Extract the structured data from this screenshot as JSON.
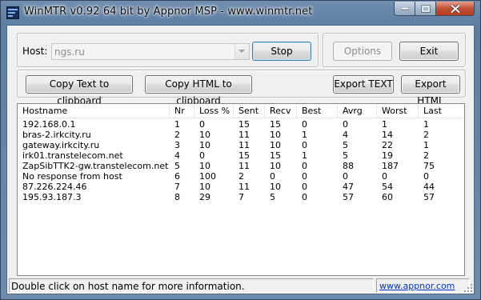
{
  "window": {
    "title": "WinMTR v0.92 64 bit by Appnor MSP - www.winmtr.net",
    "icon": "winmtr-app-icon",
    "controls": [
      "minimize-icon",
      "maximize-icon",
      "close-icon"
    ]
  },
  "host_panel": {
    "label": "Host:",
    "host_value": "ngs.ru",
    "stop_label": "Stop"
  },
  "side_panel": {
    "options_label": "Options",
    "exit_label": "Exit"
  },
  "toolbar": {
    "copy_text_label": "Copy Text to clipboard",
    "copy_html_label": "Copy HTML to clipboard",
    "export_text_label": "Export TEXT",
    "export_html_label": "Export HTML"
  },
  "table": {
    "columns": [
      "Hostname",
      "Nr",
      "Loss %",
      "Sent",
      "Recv",
      "Best",
      "Avrg",
      "Worst",
      "Last"
    ],
    "rows": [
      [
        "192.168.0.1",
        "1",
        "0",
        "15",
        "15",
        "0",
        "0",
        "1",
        "1"
      ],
      [
        "bras-2.irkcity.ru",
        "2",
        "10",
        "11",
        "10",
        "1",
        "4",
        "14",
        "2"
      ],
      [
        "gateway.irkcity.ru",
        "3",
        "10",
        "11",
        "10",
        "0",
        "5",
        "22",
        "1"
      ],
      [
        "irk01.transtelecom.net",
        "4",
        "0",
        "15",
        "15",
        "1",
        "5",
        "19",
        "2"
      ],
      [
        "ZapSibTTK2-gw.transtelecom.net",
        "5",
        "10",
        "11",
        "10",
        "0",
        "88",
        "187",
        "75"
      ],
      [
        "No response from host",
        "6",
        "100",
        "2",
        "0",
        "0",
        "0",
        "0",
        "0"
      ],
      [
        "87.226.224.46",
        "7",
        "10",
        "11",
        "10",
        "0",
        "47",
        "54",
        "44"
      ],
      [
        "195.93.187.3",
        "8",
        "29",
        "7",
        "5",
        "0",
        "57",
        "60",
        "57"
      ]
    ]
  },
  "status": {
    "message": "Double click on host name for more information.",
    "link": "www.appnor.com"
  }
}
